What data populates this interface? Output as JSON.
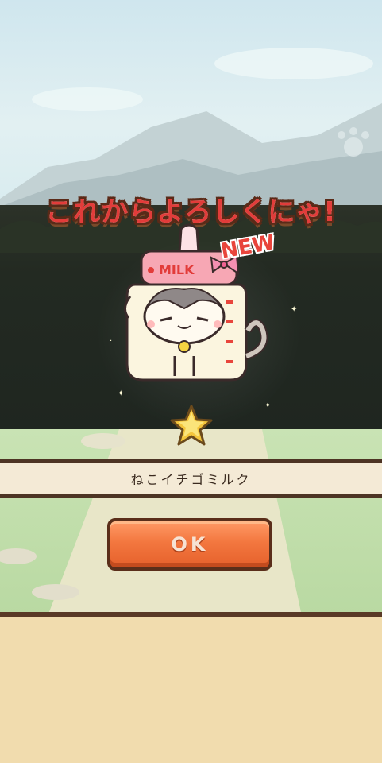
{
  "dialog": {
    "title": "これからよろしくにゃ!",
    "new_badge": "NEW",
    "item_name": "ねこイチゴミルク",
    "ok_label": "OK",
    "rarity_stars": 1
  },
  "character": {
    "bottle_label": "MILK",
    "description_icon": "cat-milk-bottle-costume"
  },
  "colors": {
    "title": "#e23c3a",
    "ok_button": "#f3773f",
    "name_bar_border": "#4d3424",
    "bottom_panel": "#f1dcae"
  }
}
